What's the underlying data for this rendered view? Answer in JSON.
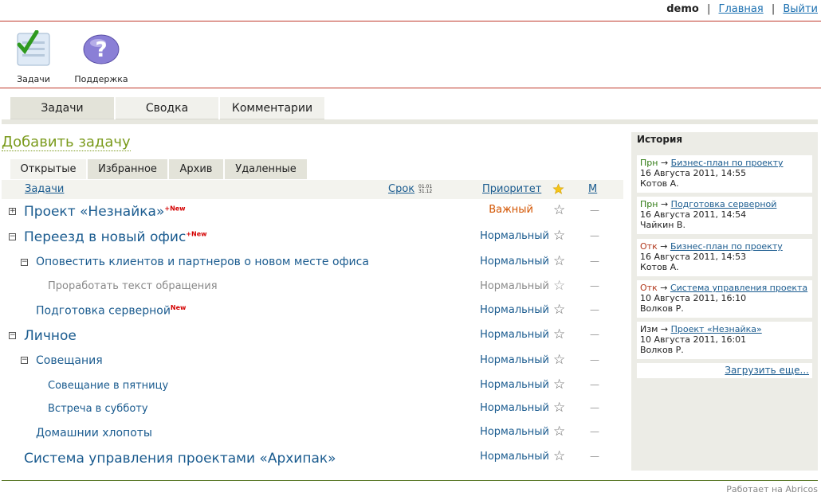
{
  "topbar": {
    "user": "demo",
    "home": "Главная",
    "logout": "Выйти"
  },
  "apps": [
    {
      "label": "Задачи",
      "icon": "tasks-checklist-icon"
    },
    {
      "label": "Поддержка",
      "icon": "support-question-icon"
    }
  ],
  "main_tabs": [
    "Задачи",
    "Сводка",
    "Комментарии"
  ],
  "add_task": "Добавить задачу",
  "sub_tabs": [
    "Открытые",
    "Избранное",
    "Архив",
    "Удаленные"
  ],
  "table": {
    "col_tasks": "Задачи",
    "col_deadline": "Срок",
    "sort_hint_top": "01.01",
    "sort_hint_bottom": "31.12",
    "col_priority": "Приоритет",
    "col_m": "М",
    "rows": [
      {
        "title": "Проект «Незнайка»",
        "new": "+New",
        "priority": "Важный",
        "toggle": "+"
      },
      {
        "title": "Переезд в новый офис",
        "new": "+New",
        "priority": "Нормальный",
        "toggle": "−"
      },
      {
        "title": "Оповестить клиентов и партнеров о новом месте офиса",
        "new": "",
        "priority": "Нормальный",
        "toggle": "−"
      },
      {
        "title": "Проработать текст обращения",
        "new": "",
        "priority": "Нормальный",
        "toggle": ""
      },
      {
        "title": "Подготовка серверной",
        "new": "New",
        "priority": "Нормальный",
        "toggle": ""
      },
      {
        "title": "Личное",
        "new": "",
        "priority": "Нормальный",
        "toggle": "−"
      },
      {
        "title": "Совещания",
        "new": "",
        "priority": "Нормальный",
        "toggle": "−"
      },
      {
        "title": "Совещание в пятницу",
        "new": "",
        "priority": "Нормальный",
        "toggle": ""
      },
      {
        "title": "Встреча в субботу",
        "new": "",
        "priority": "Нормальный",
        "toggle": ""
      },
      {
        "title": "Домашнии хлопоты",
        "new": "",
        "priority": "Нормальный",
        "toggle": ""
      },
      {
        "title": "Система управления проектами «Архипак»",
        "new": "",
        "priority": "Нормальный",
        "toggle": ""
      }
    ],
    "star": "☆",
    "dash": "—"
  },
  "history": {
    "title": "История",
    "items": [
      {
        "action": "Прн",
        "arrow": "→",
        "link": "Бизнес-план по проекту",
        "date": "16 Августа 2011, 14:55",
        "user": "Котов А."
      },
      {
        "action": "Прн",
        "arrow": "→",
        "link": "Подготовка серверной",
        "date": "16 Августа 2011, 14:54",
        "user": "Чайкин В."
      },
      {
        "action": "Отк",
        "arrow": "→",
        "link": "Бизнес-план по проекту",
        "date": "16 Августа 2011, 14:53",
        "user": "Котов А."
      },
      {
        "action": "Отк",
        "arrow": "→",
        "link": "Система управления проекта",
        "date": "10 Августа 2011, 16:10",
        "user": "Волков Р."
      },
      {
        "action": "Изм",
        "arrow": "→",
        "link": "Проект «Незнайка»",
        "date": "10 Августа 2011, 16:01",
        "user": "Волков Р."
      }
    ],
    "more": "Загрузить еще..."
  },
  "footer": "Работает на Abricos",
  "colors": {
    "accent_green": "#7a9a1b",
    "link_blue": "#1a5b8f",
    "priority_high": "#d35400",
    "rule_red": "#c0392b"
  }
}
